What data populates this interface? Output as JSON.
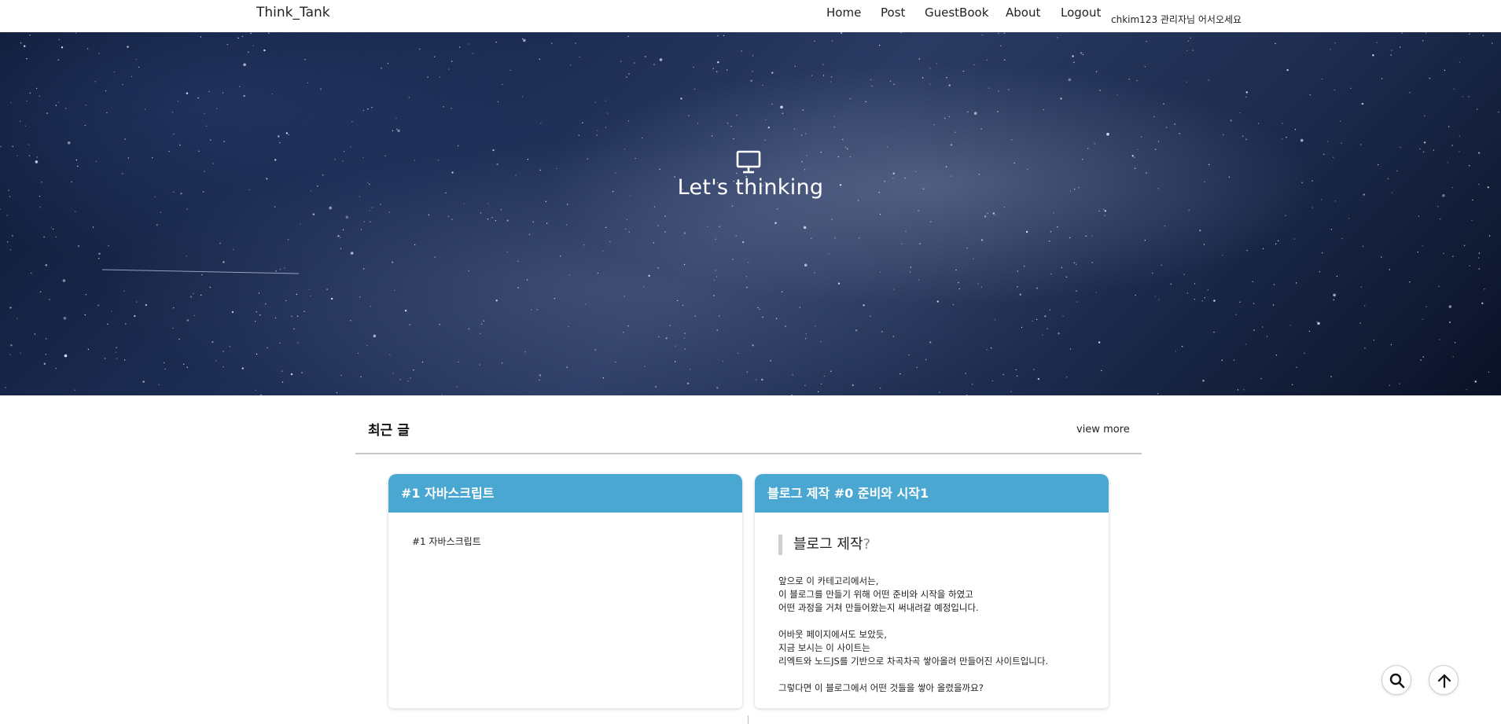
{
  "header": {
    "brand": "Think_Tank",
    "nav": [
      {
        "label": "Home"
      },
      {
        "label": "Post"
      },
      {
        "label": "GuestBook"
      },
      {
        "label": "About"
      },
      {
        "label": "Logout"
      }
    ],
    "welcome": "chkim123 관리자님 어서오세요"
  },
  "hero": {
    "icon": "monitor-icon",
    "title": "Let's thinking"
  },
  "recent": {
    "title": "최근 글",
    "view_more": "view more"
  },
  "posts": [
    {
      "title": "#1 자바스크립트",
      "excerpt": "#1 자바스크립트"
    },
    {
      "title": "블로그 제작 #0 준비와 시작1",
      "quote": "블로그 제작",
      "quote_mark": "?",
      "lines": [
        "앞으로 이 카테고리에서는,",
        "이 블로그를 만들기 위해 어떤 준비와 시작을 하였고",
        "어떤 과정을 거쳐 만들어왔는지 써내려갈 예정입니다.",
        "",
        "어바웃 페이지에서도 보았듯,",
        "지금 보시는 이 사이트는",
        "리엑트와 노드JS를 기반으로 차곡차곡 쌓아올려 만들어진 사이트입니다.",
        "",
        "그렇다면 이 블로그에서 어떤 것들을 쌓아 올렸을까요?"
      ]
    }
  ],
  "floating": {
    "search_icon": "search-icon",
    "top_icon": "arrow-up-icon"
  },
  "colors": {
    "card_header": "#4aa7d1",
    "hero_bg": "#1c2c52"
  }
}
